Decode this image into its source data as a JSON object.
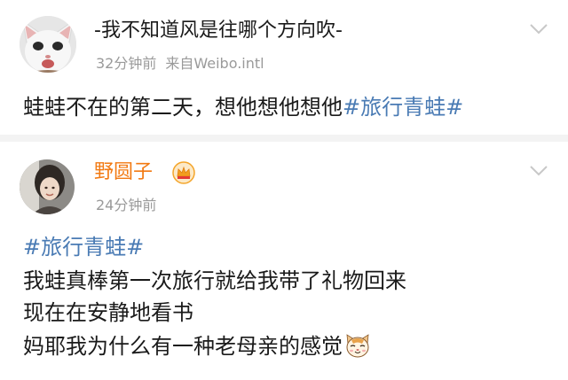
{
  "posts": [
    {
      "author": "-我不知道风是往哪个方向吹-",
      "time": "32分钟前",
      "source": "来自Weibo.intl",
      "text_before": "蛙蛙不在的第二天，想他想他想他",
      "hashtag": "#旅行青蛙#",
      "avatar_icon": "cat-avatar-icon",
      "menu_icon": "chevron-down-icon"
    },
    {
      "author": "野圆子",
      "time": "24分钟前",
      "hashtag": "#旅行青蛙#",
      "lines": [
        "我蛙真棒第一次旅行就给我带了礼物回来",
        "现在在安静地看书",
        "妈耶我为什么有一种老母亲的感觉"
      ],
      "badge_icon": "crown-icon",
      "emoji_icon": "cat-face-emoji-icon",
      "avatar_icon": "girl-avatar-icon",
      "menu_icon": "chevron-down-icon"
    }
  ],
  "colors": {
    "hashtag": "#4a7bb4",
    "vip_name": "#f27a13",
    "meta": "#9a9a9a",
    "divider": "#f3f3f3"
  }
}
